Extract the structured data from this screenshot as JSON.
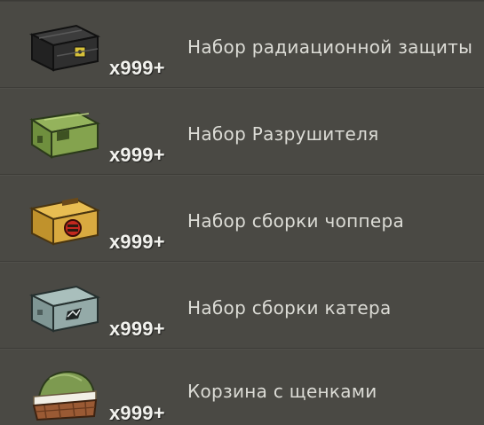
{
  "items": [
    {
      "name": "Набор Разрушителя",
      "quantity": "x999+",
      "icon": "green-ammo-crate-icon",
      "color": "#7a9a4a"
    },
    {
      "name": "Набор сборки чоппера",
      "quantity": "x999+",
      "icon": "yellow-chopper-crate-icon",
      "color": "#d4a53a"
    },
    {
      "name": "Набор сборки катера",
      "quantity": "x999+",
      "icon": "blue-boat-crate-icon",
      "color": "#8aa0a0"
    },
    {
      "name": "Корзина с щенками",
      "quantity": "x999+",
      "icon": "puppy-basket-icon",
      "color": "#a0623a"
    },
    {
      "name": "Набор радиационной защиты",
      "quantity": "x999+",
      "icon": "radiation-crate-icon",
      "color": "#2e2e2e"
    }
  ]
}
